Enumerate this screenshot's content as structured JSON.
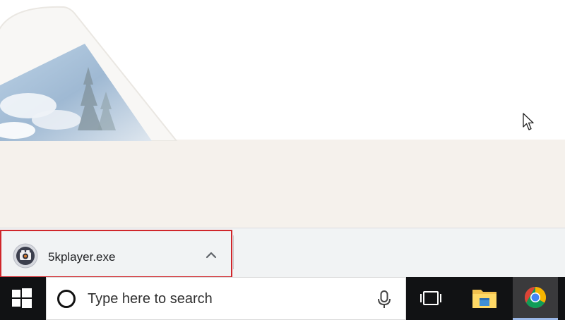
{
  "download_shelf": {
    "item": {
      "file_name": "5kplayer.exe",
      "icon": "5kplayer-app-icon",
      "highlight_color": "#d0262b"
    },
    "expand_icon": "chevron-up-icon"
  },
  "taskbar": {
    "start_icon": "windows-logo-icon",
    "search": {
      "placeholder": "Type here to search",
      "left_icon": "cortana-icon",
      "right_icon": "microphone-icon"
    },
    "apps": [
      {
        "name": "Task View",
        "icon": "task-view-icon"
      },
      {
        "name": "File Explorer",
        "icon": "folder-icon"
      },
      {
        "name": "Google Chrome",
        "icon": "chrome-icon",
        "active": true
      }
    ]
  },
  "colors": {
    "taskbar_bg": "#111214",
    "shelf_bg": "#f1f3f4",
    "page_band": "#f5f1ec"
  }
}
